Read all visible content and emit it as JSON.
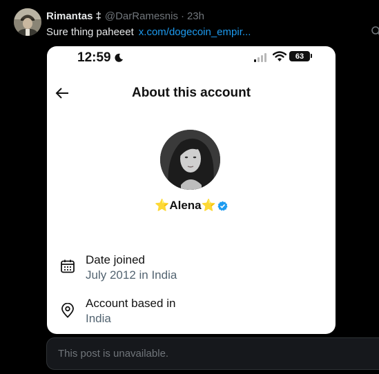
{
  "tweet": {
    "display_name": "Rimantas",
    "name_badge": "‡",
    "handle": "@DarRamesnis",
    "separator": "·",
    "time": "23h",
    "text": "Sure thing paheeet",
    "link": "x.com/dogecoin_empir..."
  },
  "embedded_screenshot": {
    "status_bar": {
      "time": "12:59",
      "battery": "63"
    },
    "title": "About this account",
    "profile": {
      "name": "⭐Alena⭐",
      "verified": true
    },
    "rows": [
      {
        "label": "Date joined",
        "value": "July 2012 in India",
        "icon": "calendar-icon"
      },
      {
        "label": "Account based in",
        "value": "India",
        "icon": "location-pin-icon"
      }
    ]
  },
  "unavailable_notice": "This post is unavailable.",
  "colors": {
    "background": "#000000",
    "link": "#1d9bf0",
    "verified": "#1d9bf0",
    "text_primary": "#e7e9ea",
    "text_secondary": "#71767b"
  }
}
